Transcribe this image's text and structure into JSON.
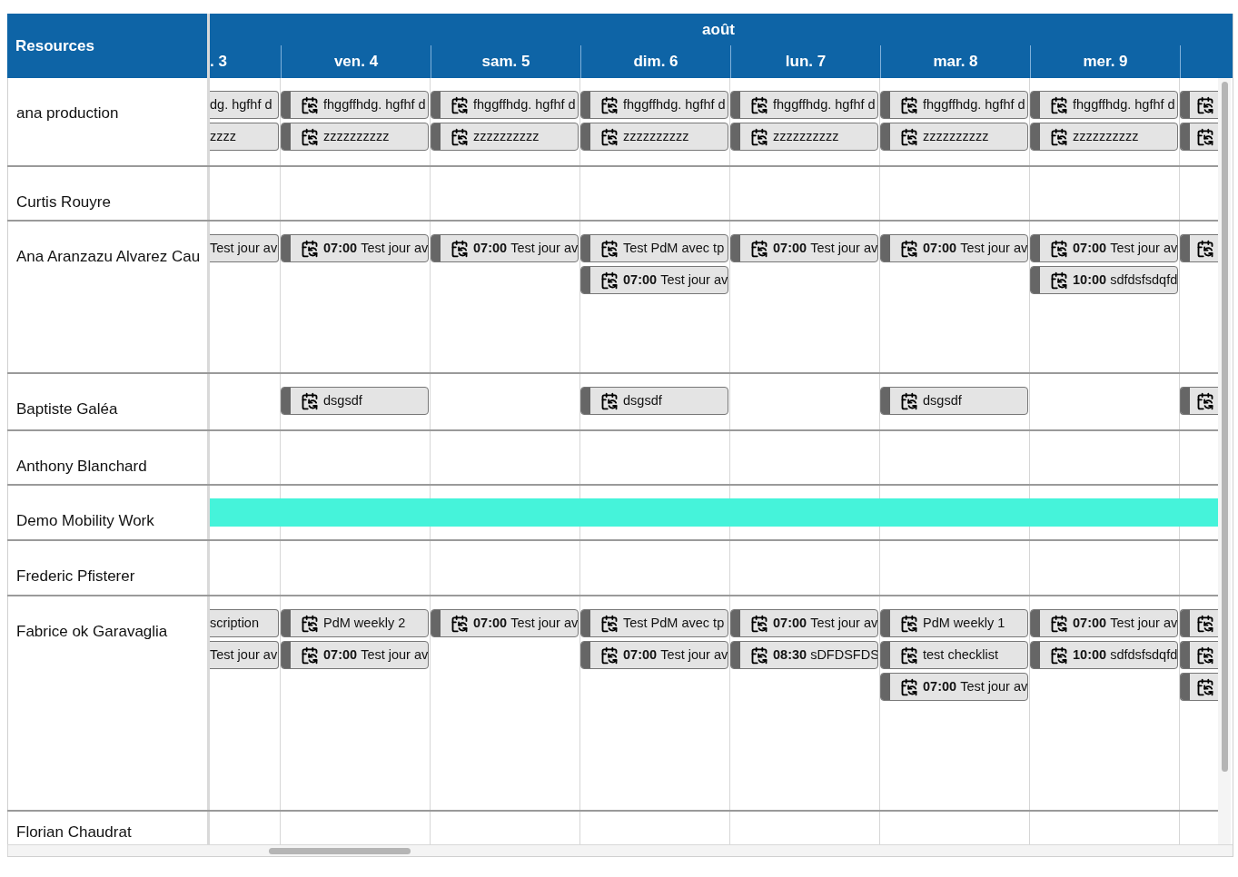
{
  "header": {
    "resources_label": "Resources",
    "month": "août",
    "days": [
      ". 3",
      "ven. 4",
      "sam. 5",
      "dim. 6",
      "lun. 7",
      "mar. 8",
      "mer. 9"
    ]
  },
  "rows": [
    {
      "name": "ana production",
      "cells": {
        "col_1": [
          {
            "title": "dg. hgfhf d"
          },
          {
            "title": "zzzz"
          }
        ],
        "col_2": [
          {
            "kind": "recurring",
            "title": "fhggffhdg. hgfhf d"
          },
          {
            "kind": "recurring",
            "title": "zzzzzzzzzz"
          }
        ],
        "col_3": [
          {
            "kind": "recurring",
            "title": "fhggffhdg. hgfhf d"
          },
          {
            "kind": "recurring",
            "title": "zzzzzzzzzz"
          }
        ],
        "col_4": [
          {
            "kind": "recurring",
            "title": "fhggffhdg. hgfhf d"
          },
          {
            "kind": "recurring",
            "title": "zzzzzzzzzz"
          }
        ],
        "col_5": [
          {
            "kind": "recurring",
            "title": "fhggffhdg. hgfhf d"
          },
          {
            "kind": "recurring",
            "title": "zzzzzzzzzz"
          }
        ],
        "col_6": [
          {
            "kind": "recurring",
            "title": "fhggffhdg. hgfhf d"
          },
          {
            "kind": "recurring",
            "title": "zzzzzzzzzz"
          }
        ],
        "col_7": [
          {
            "kind": "recurring",
            "title": "fhggffhdg. hgfhf d"
          },
          {
            "kind": "recurring",
            "title": "zzzzzzzzzz"
          }
        ],
        "col_8": [
          {
            "kind": "recurring"
          },
          {
            "kind": "recurring"
          }
        ]
      }
    },
    {
      "name": "Curtis Rouyre"
    },
    {
      "name": "Ana Aranzazu Alvarez Cau",
      "cells": {
        "col_1": [
          {
            "title": "Test jour av"
          }
        ],
        "col_2": [
          {
            "kind": "recurring",
            "time": "07:00",
            "title": "Test jour av"
          }
        ],
        "col_3": [
          {
            "kind": "recurring",
            "time": "07:00",
            "title": "Test jour av"
          }
        ],
        "col_4": [
          {
            "kind": "recurring",
            "title": "Test PdM avec tp"
          },
          {
            "kind": "recurring",
            "time": "07:00",
            "title": "Test jour av"
          }
        ],
        "col_5": [
          {
            "kind": "recurring",
            "time": "07:00",
            "title": "Test jour av"
          }
        ],
        "col_6": [
          {
            "kind": "recurring",
            "time": "07:00",
            "title": "Test jour av"
          }
        ],
        "col_7": [
          {
            "kind": "recurring",
            "time": "07:00",
            "title": "Test jour av"
          },
          {
            "kind": "recurring",
            "time": "10:00",
            "title": "sdfdsfsdqfd"
          }
        ],
        "col_8": [
          {
            "kind": "recurring"
          }
        ]
      }
    },
    {
      "name": "Baptiste Galéa",
      "cells": {
        "col_2": [
          {
            "kind": "recurring",
            "title": "dsgsdf"
          }
        ],
        "col_4": [
          {
            "kind": "recurring",
            "title": "dsgsdf"
          }
        ],
        "col_6": [
          {
            "kind": "recurring",
            "title": "dsgsdf"
          }
        ],
        "col_8": [
          {
            "kind": "recurring"
          }
        ]
      }
    },
    {
      "name": "Anthony Blanchard"
    },
    {
      "name": "Demo Mobility Work",
      "bar": {
        "color": "#45f3da"
      }
    },
    {
      "name": "Frederic Pfisterer"
    },
    {
      "name": "Fabrice ok Garavaglia",
      "cells": {
        "col_1": [
          {
            "title": "scription"
          },
          {
            "title": "Test jour av"
          }
        ],
        "col_2": [
          {
            "kind": "recurring",
            "title": "PdM weekly 2"
          },
          {
            "kind": "recurring",
            "time": "07:00",
            "title": "Test jour av"
          }
        ],
        "col_3": [
          {
            "kind": "recurring",
            "time": "07:00",
            "title": "Test jour av"
          }
        ],
        "col_4": [
          {
            "kind": "recurring",
            "title": "Test PdM avec tp"
          },
          {
            "kind": "recurring",
            "time": "07:00",
            "title": "Test jour av"
          }
        ],
        "col_5": [
          {
            "kind": "recurring",
            "time": "07:00",
            "title": "Test jour av"
          },
          {
            "kind": "recurring",
            "time": "08:30",
            "title": "sDFDSFDS"
          }
        ],
        "col_6": [
          {
            "kind": "recurring",
            "title": "PdM weekly 1"
          },
          {
            "kind": "recurring",
            "title": "test checklist"
          },
          {
            "kind": "recurring",
            "time": "07:00",
            "title": "Test jour av"
          }
        ],
        "col_7": [
          {
            "kind": "recurring",
            "time": "07:00",
            "title": "Test jour av"
          },
          {
            "kind": "recurring",
            "time": "10:00",
            "title": "sdfdsfsdqfd"
          }
        ],
        "col_8": [
          {
            "kind": "recurring"
          },
          {
            "kind": "recurring"
          },
          {
            "kind": "recurring"
          }
        ]
      }
    },
    {
      "name": "Florian Chaudrat"
    }
  ]
}
